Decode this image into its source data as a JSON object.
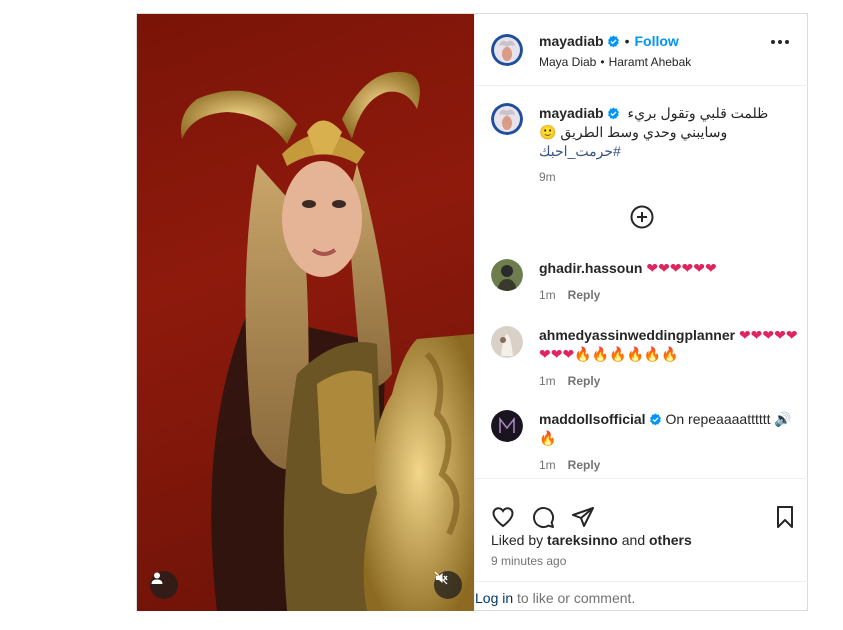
{
  "header": {
    "username": "mayadiab",
    "follow_label": "Follow",
    "subtitle_name": "Maya Diab",
    "subtitle_song": "Haramt Ahebak"
  },
  "caption": {
    "username": "mayadiab",
    "line1": "ظلمت قلبي وتقول بريء",
    "line2": "وسايبني وحدي وسط الطريق 🙂",
    "hashtag": "#حرمت_احبك",
    "time": "9m"
  },
  "comments": [
    {
      "username": "ghadir.hassoun",
      "text": "❤❤❤❤❤❤",
      "time": "1m",
      "reply": "Reply"
    },
    {
      "username": "ahmedyassinweddingplanner",
      "text": "❤❤❤❤❤❤❤❤🔥🔥🔥🔥🔥🔥",
      "time": "1m",
      "reply": "Reply"
    },
    {
      "username": "maddollsofficial",
      "text": "On repeaaaatttttt 🔊🔥",
      "time": "1m",
      "reply": "Reply"
    }
  ],
  "likes": {
    "prefix": "Liked by",
    "user": "tareksinno",
    "and": "and",
    "others": "others"
  },
  "timestamp": "9 minutes ago",
  "login": {
    "link": "Log in",
    "rest": "to like or comment."
  },
  "colors": {
    "accent": "#0095f6",
    "verified": "#0095f6",
    "media_bg": "#8e1a0c"
  },
  "icons": [
    "more-icon",
    "heart-icon",
    "comment-icon",
    "share-icon",
    "save-icon",
    "add-circle-icon",
    "user-icon",
    "mute-icon",
    "verified-icon"
  ]
}
